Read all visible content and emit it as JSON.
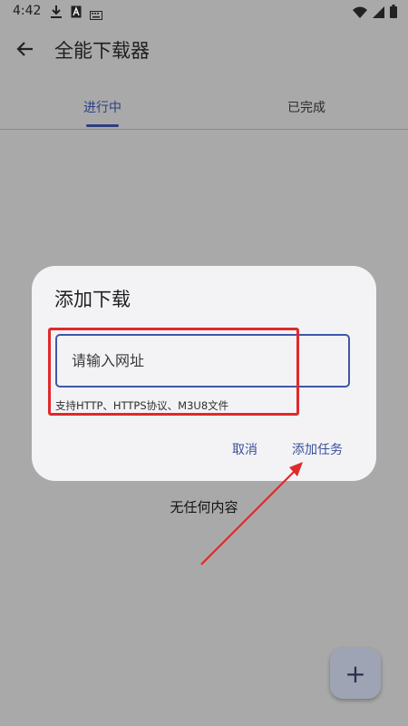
{
  "status_bar": {
    "time": "4:42",
    "icons": [
      "download-icon",
      "a-icon",
      "keyboard-icon",
      "wifi-icon",
      "signal-icon",
      "battery-icon"
    ]
  },
  "app_bar": {
    "title": "全能下载器",
    "back_icon": "arrow-left-icon"
  },
  "tabs": [
    {
      "label": "进行中",
      "selected": true
    },
    {
      "label": "已完成",
      "selected": false
    }
  ],
  "empty_text": "无任何内容",
  "dialog": {
    "title": "添加下载",
    "url_placeholder": "请输入网址",
    "helper_text": "支持HTTP、HTTPS协议、M3U8文件",
    "cancel_label": "取消",
    "add_label": "添加任务"
  },
  "fab": {
    "label": "+",
    "icon": "plus-icon"
  },
  "colors": {
    "accent": "#2d3f82",
    "highlight": "#e0292a",
    "scrim": "#a9a9a9",
    "dialog_bg": "#f3f3f6"
  }
}
